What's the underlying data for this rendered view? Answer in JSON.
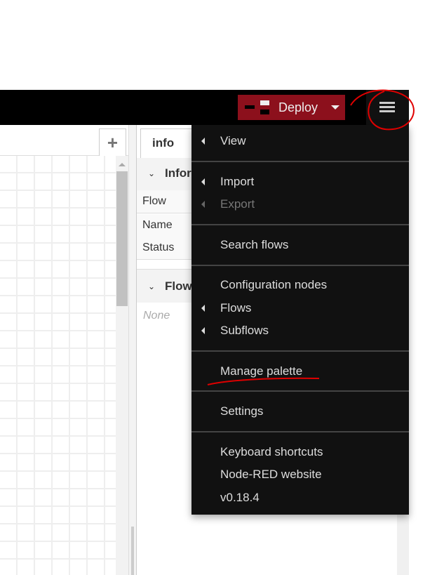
{
  "header": {
    "deploy_label": "Deploy",
    "menu_button": "menu-icon"
  },
  "workspace": {
    "add_tab_label": "+"
  },
  "sidebar": {
    "tab_label": "info",
    "info_section": "Information",
    "rows": [
      "Flow",
      "Name",
      "Status"
    ],
    "flow_section": "Flow",
    "flow_value": "None"
  },
  "menu": {
    "items": [
      {
        "label": "View",
        "submenu": true,
        "disabled": false
      },
      {
        "label": "Import",
        "submenu": true,
        "disabled": false
      },
      {
        "label": "Export",
        "submenu": true,
        "disabled": true
      },
      {
        "label": "Search flows",
        "submenu": false,
        "disabled": false
      },
      {
        "label": "Configuration nodes",
        "submenu": false,
        "disabled": false
      },
      {
        "label": "Flows",
        "submenu": true,
        "disabled": false
      },
      {
        "label": "Subflows",
        "submenu": true,
        "disabled": false
      },
      {
        "label": "Manage palette",
        "submenu": false,
        "disabled": false
      },
      {
        "label": "Settings",
        "submenu": false,
        "disabled": false
      },
      {
        "label": "Keyboard shortcuts",
        "submenu": false,
        "disabled": false
      },
      {
        "label": "Node-RED website",
        "submenu": false,
        "disabled": false
      },
      {
        "label": "v0.18.4",
        "submenu": false,
        "disabled": false
      }
    ]
  },
  "colors": {
    "deploy": "#8c101c",
    "annotation": "#e00000"
  }
}
